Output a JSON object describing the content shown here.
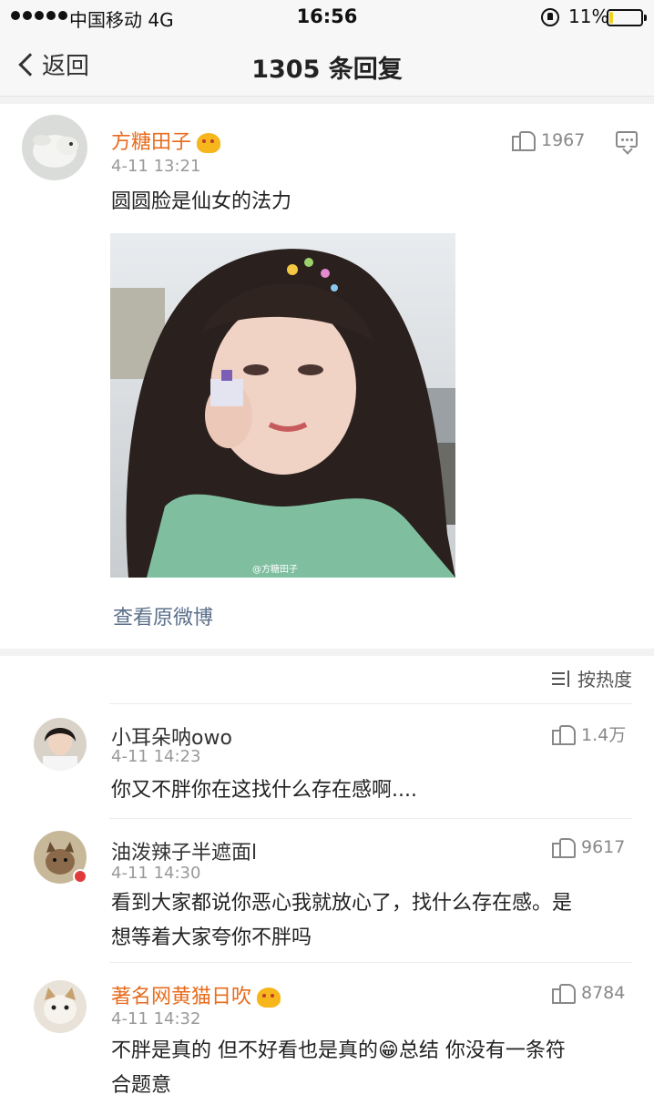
{
  "status_bar": {
    "carrier": "中国移动 4G",
    "time": "16:56",
    "battery_percent_text": "11%",
    "battery_level": 0.11
  },
  "nav": {
    "back_label": "返回",
    "title": "1305 条回复"
  },
  "post": {
    "author": "方糖田子",
    "time": "4-11 13:21",
    "likes": "1967",
    "text": "圆圆脸是仙女的法力",
    "watermark": "@方糖田子",
    "view_original": "查看原微博"
  },
  "comments_header": {
    "sort_label": "按热度"
  },
  "comments": [
    {
      "author": "小耳朵呐owo",
      "time": "4-11 14:23",
      "likes": "1.4万",
      "text": "你又不胖你在这找什么存在感啊....",
      "vip": false
    },
    {
      "author": "油泼辣子半遮面l",
      "time": "4-11 14:30",
      "likes": "9617",
      "text_line1": "看到大家都说你恶心我就放心了，找什么存在感。是",
      "text_line2": "想等着大家夸你不胖吗",
      "vip": false
    },
    {
      "author": "著名网黄猫日吹",
      "time": "4-11 14:32",
      "likes": "8784",
      "text_line1": "不胖是真的 但不好看也是真的😁总结 你没有一条符",
      "text_line2": "合题意",
      "vip": true
    }
  ],
  "colors": {
    "vip_name": "#e86c1d",
    "link": "#5b6f8a",
    "battery": "#f0d21a"
  }
}
